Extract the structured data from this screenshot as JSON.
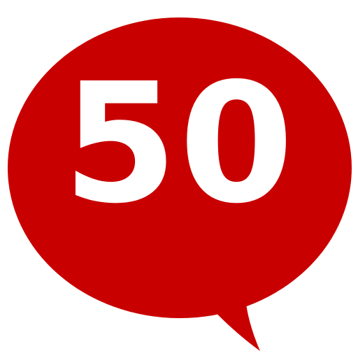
{
  "logo": {
    "number": "50",
    "bubble_color": "#c90000",
    "text_color": "#ffffff",
    "icon": "speech-bubble-icon"
  }
}
